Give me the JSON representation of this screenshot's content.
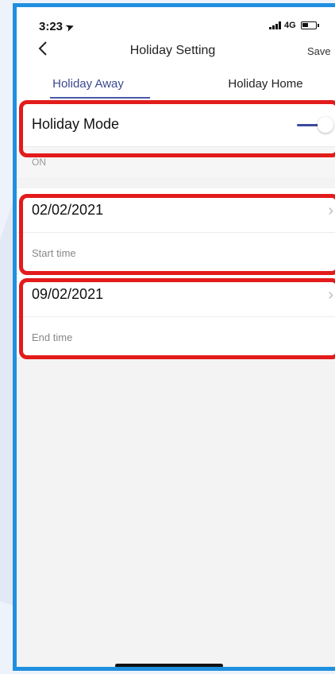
{
  "status_bar": {
    "time": "3:23",
    "location_arrow": "location-arrow-icon",
    "network": "4G"
  },
  "nav": {
    "back_icon": "chevron-left-icon",
    "title": "Holiday Setting",
    "save_label": "Save"
  },
  "tabs": [
    {
      "label": "Holiday Away",
      "active": true
    },
    {
      "label": "Holiday Home",
      "active": false
    }
  ],
  "holiday_mode": {
    "title": "Holiday Mode",
    "enabled": true,
    "status_text": "ON"
  },
  "start": {
    "date": "02/02/2021",
    "label": "Start time"
  },
  "end": {
    "date": "09/02/2021",
    "label": "End time"
  },
  "colors": {
    "frame": "#1f8fe0",
    "highlight": "#e31b1b",
    "accent": "#3b4aa0"
  }
}
